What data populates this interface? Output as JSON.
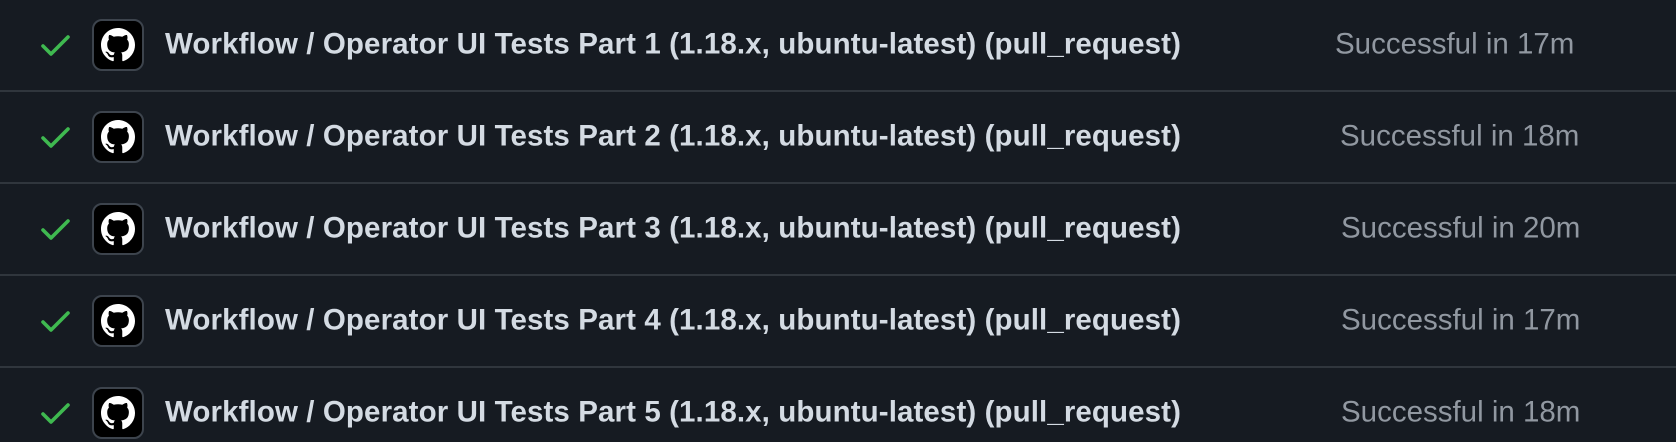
{
  "colors": {
    "background": "#161b22",
    "divider": "#30363d",
    "success": "#3fb950",
    "title_text": "#d4dbe3",
    "muted_text": "#9198a1"
  },
  "checks": [
    {
      "status_icon": "check-icon",
      "avatar_icon": "github-icon",
      "name": "Workflow / Operator UI Tests Part 1 (1.18.x, ubuntu-latest) (pull_request)",
      "status": "Successful in 17m"
    },
    {
      "status_icon": "check-icon",
      "avatar_icon": "github-icon",
      "name": "Workflow / Operator UI Tests Part 2 (1.18.x, ubuntu-latest) (pull_request)",
      "status": "Successful in 18m"
    },
    {
      "status_icon": "check-icon",
      "avatar_icon": "github-icon",
      "name": "Workflow / Operator UI Tests Part 3 (1.18.x, ubuntu-latest) (pull_request)",
      "status": "Successful in 20m"
    },
    {
      "status_icon": "check-icon",
      "avatar_icon": "github-icon",
      "name": "Workflow / Operator UI Tests Part 4 (1.18.x, ubuntu-latest) (pull_request)",
      "status": "Successful in 17m"
    },
    {
      "status_icon": "check-icon",
      "avatar_icon": "github-icon",
      "name": "Workflow / Operator UI Tests Part 5 (1.18.x, ubuntu-latest) (pull_request)",
      "status": "Successful in 18m"
    }
  ]
}
